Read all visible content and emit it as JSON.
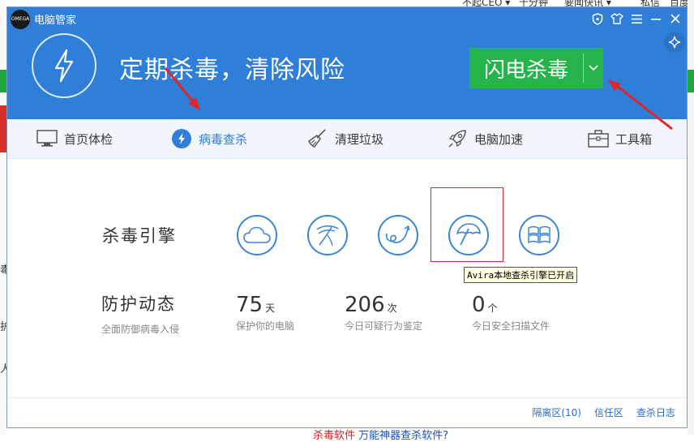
{
  "background": {
    "top_texts": [
      "不起CEO ▾",
      "十分钟",
      "要闻快讯 ▾",
      "私信",
      "百度"
    ],
    "bottom_text_red": "杀毒软件",
    "bottom_text_blue": "万能神器查杀软件?",
    "left_chars": [
      "毒",
      "护",
      "人"
    ]
  },
  "window": {
    "title": "电脑管家",
    "logo_text": "OMEGA",
    "headline": "定期杀毒，清除风险",
    "flash_button": "闪电杀毒",
    "header_color": "#2f7ed8",
    "button_color": "#25b34b"
  },
  "tabs": [
    {
      "label": "首页体检",
      "icon": "monitor-icon"
    },
    {
      "label": "病毒查杀",
      "icon": "bolt-icon",
      "active": true
    },
    {
      "label": "清理垃圾",
      "icon": "broom-icon"
    },
    {
      "label": "电脑加速",
      "icon": "rocket-icon"
    },
    {
      "label": "工具箱",
      "icon": "toolbox-icon"
    }
  ],
  "engines": {
    "label": "杀毒引擎",
    "icons": [
      "cloud-engine-icon",
      "tencent-engine-icon",
      "local-engine-icon",
      "avira-umbrella-icon",
      "windows-engine-icon"
    ],
    "tooltip": "Avira本地查杀引擎已开启"
  },
  "protection": {
    "label": "防护动态",
    "sub": "全面防御病毒入侵",
    "stats": [
      {
        "num": "75",
        "unit": "天",
        "desc": "保护你的电脑"
      },
      {
        "num": "206",
        "unit": "次",
        "desc": "今日可疑行为鉴定"
      },
      {
        "num": "0",
        "unit": "个",
        "desc": "今日安全扫描文件"
      }
    ]
  },
  "footer": {
    "quarantine": "隔离区(10)",
    "trust": "信任区",
    "log": "查杀日志"
  }
}
